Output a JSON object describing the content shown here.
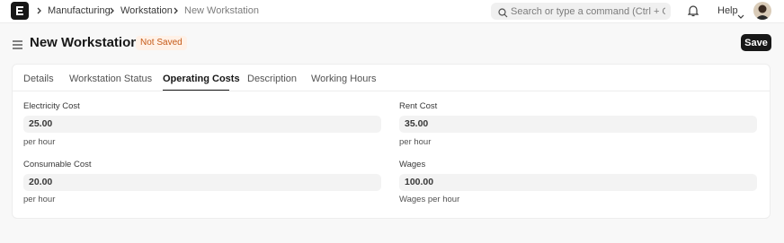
{
  "navbar": {
    "breadcrumbs": [
      "Manufacturing",
      "Workstation",
      "New Workstation"
    ],
    "search_placeholder": "Search or type a command (Ctrl + G)",
    "help_label": "Help"
  },
  "page": {
    "title": "New Workstation",
    "status": "Not Saved",
    "save_label": "Save"
  },
  "tabs": [
    "Details",
    "Workstation Status",
    "Operating Costs",
    "Description",
    "Working Hours"
  ],
  "active_tab": "Operating Costs",
  "fields": {
    "electricity": {
      "label": "Electricity Cost",
      "value": "25.00",
      "description": "per hour"
    },
    "rent": {
      "label": "Rent Cost",
      "value": "35.00",
      "description": "per hour"
    },
    "consumable": {
      "label": "Consumable Cost",
      "value": "20.00",
      "description": "per hour"
    },
    "wages": {
      "label": "Wages",
      "value": "100.00",
      "description": "Wages per hour"
    }
  },
  "colors": {
    "brand": "#171717",
    "status_text": "#c55a18",
    "status_bg": "#fff1e7"
  }
}
